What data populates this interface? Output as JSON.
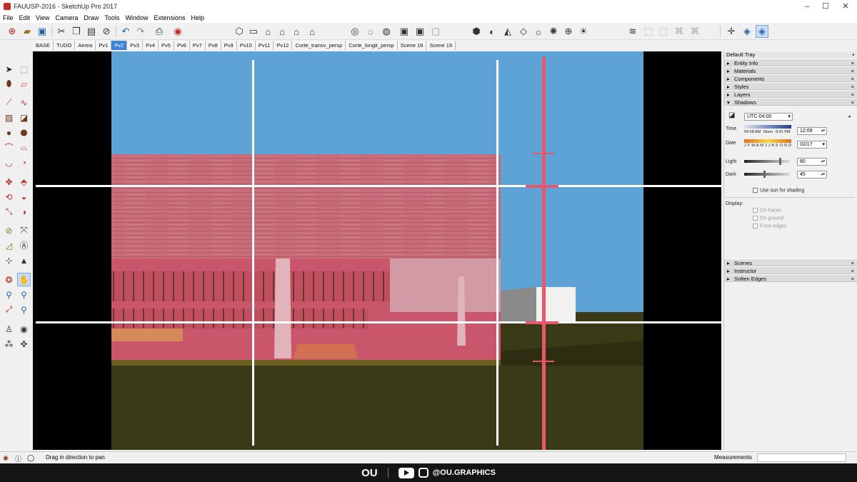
{
  "window": {
    "title": "FAUUSP-2016 - SketchUp Pro 2017",
    "controls": [
      "–",
      "☐",
      "✕"
    ]
  },
  "menu": [
    "File",
    "Edit",
    "View",
    "Camera",
    "Draw",
    "Tools",
    "Window",
    "Extensions",
    "Help"
  ],
  "scene_tabs": [
    "BASE",
    "TUDO",
    "Aerea",
    "Pv1",
    "Pv2",
    "Pv3",
    "Pv4",
    "Pv5",
    "Pv6",
    "Pv7",
    "Pv8",
    "Pv9",
    "Pv10",
    "Pv11",
    "Pv12",
    "Corte_transv_persp",
    "Corte_longit_persp",
    "Scene 18",
    "Scene 19"
  ],
  "active_scene": "Pv2",
  "tray": {
    "title": "Default Tray",
    "panels_top": [
      "Entity Info",
      "Materials",
      "Components",
      "Styles",
      "Layers"
    ],
    "shadows": {
      "label": "Shadows",
      "timezone": "UTC-04:00",
      "time_label": "Time",
      "sunrise": "04:58 AM",
      "noon": "Noon",
      "sunset": "6:41 PM",
      "time_value": "12:09",
      "date_label": "Date",
      "months": "J F M A M J J A S O N D",
      "date_value": "02/17",
      "light_label": "Light",
      "light_value": "80",
      "light_level": 80,
      "dark_label": "Dark",
      "dark_value": "45",
      "dark_level": 45,
      "use_sun": "Use sun for shading",
      "display_label": "Display:",
      "on_faces": "On Faces",
      "on_ground": "On ground",
      "from_edges": "From edges"
    },
    "panels_bottom": [
      "Scenes",
      "Instructor",
      "Soften Edges"
    ]
  },
  "status": {
    "message": "Drag in direction to pan",
    "measurements_label": "Measurements"
  },
  "branding": {
    "logo": "OU",
    "handle": "@OU.GRAPHICS"
  },
  "colors": {
    "sky": "#5ea3d6",
    "ground": "#3b3a17",
    "overlay": "#d6455f",
    "accent": "#3c83d9"
  }
}
